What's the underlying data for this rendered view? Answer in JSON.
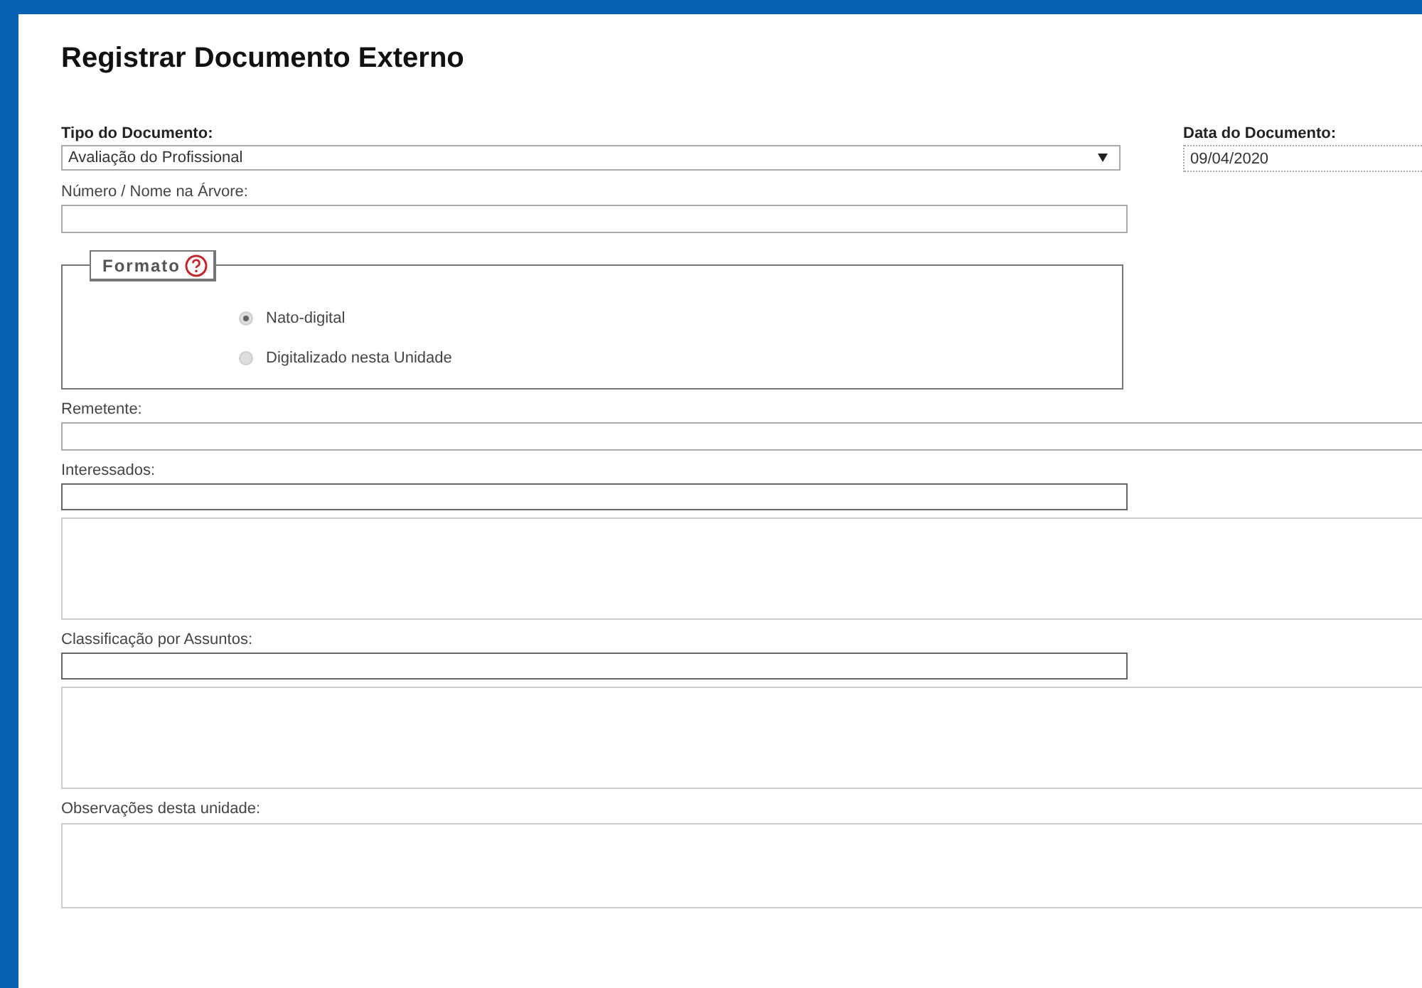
{
  "title": "Registrar Documento Externo",
  "document_type": {
    "label": "Tipo do Documento:",
    "value": "Avaliação do Profissional"
  },
  "document_date": {
    "label": "Data do Documento:",
    "value": "09/04/2020"
  },
  "tree_name": {
    "label": "Número / Nome na Árvore:"
  },
  "format": {
    "legend": "Formato",
    "options": [
      {
        "label": "Nato-digital",
        "selected": true
      },
      {
        "label": "Digitalizado nesta Unidade",
        "selected": false
      }
    ]
  },
  "fields": [
    {
      "kind": "text",
      "label": "Remetente:"
    },
    {
      "kind": "lookup",
      "label": "Interessados:"
    },
    {
      "kind": "lookup",
      "label": "Classificação por Assuntos:"
    },
    {
      "kind": "notes",
      "label": "Observações desta unidade:"
    }
  ]
}
